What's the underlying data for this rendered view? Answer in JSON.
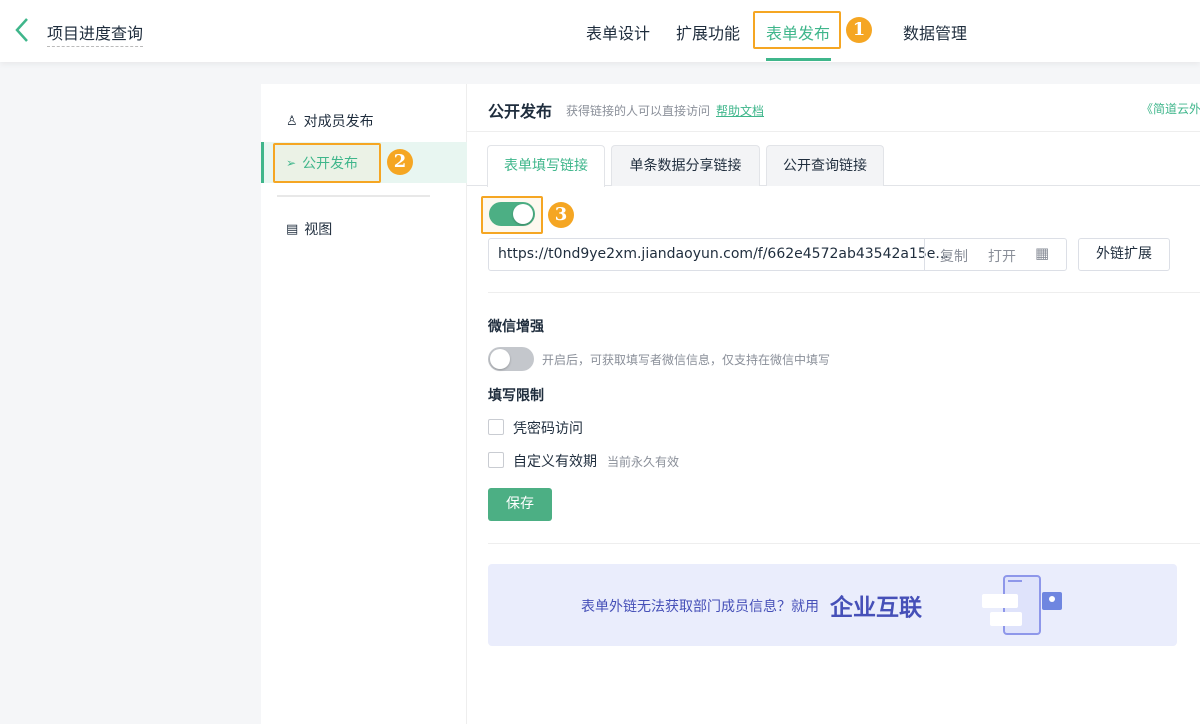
{
  "header": {
    "title": "项目进度查询",
    "nav": [
      "表单设计",
      "扩展功能",
      "表单发布",
      "数据管理"
    ],
    "active_nav": "表单发布"
  },
  "annotations": [
    "1",
    "2",
    "3"
  ],
  "sidebar": {
    "items": [
      {
        "label": "对成员发布",
        "icon": "user-share-icon"
      },
      {
        "label": "公开发布",
        "icon": "send-icon",
        "active": true
      },
      {
        "label": "视图",
        "icon": "list-icon"
      }
    ]
  },
  "main": {
    "title": "公开发布",
    "subtitle": "获得链接的人可以直接访问",
    "help_link": "帮助文档",
    "right_link": "《简道云外",
    "tabs": [
      "表单填写链接",
      "单条数据分享链接",
      "公开查询链接"
    ],
    "link_enabled": true,
    "url": "https://t0nd9ye2xm.jiandaoyun.com/f/662e4572ab43542a15e...",
    "copy": "复制",
    "open": "打开",
    "qr_icon": "qrcode-icon",
    "extend": "外链扩展",
    "wechat": {
      "title": "微信增强",
      "enabled": false,
      "desc": "开启后，可获取填写者微信信息，仅支持在微信中填写"
    },
    "limit": {
      "title": "填写限制",
      "password": "凭密码访问",
      "validity": "自定义有效期",
      "validity_note": "当前永久有效"
    },
    "save": "保存",
    "banner": {
      "text": "表单外链无法获取部门成员信息？就用",
      "highlight": "企业互联"
    }
  },
  "colors": {
    "accent": "#3fb68b",
    "annotation": "#f5a623",
    "banner_bg": "#eaedfc",
    "banner_text": "#4650b8"
  }
}
